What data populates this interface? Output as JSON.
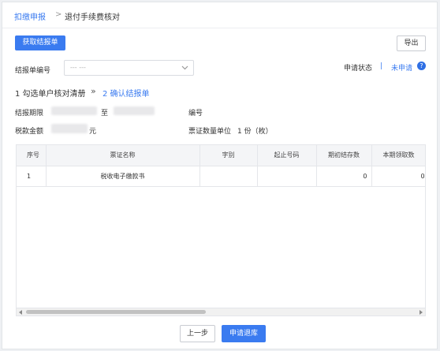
{
  "breadcrumb": {
    "parent": "扣缴申报",
    "separator": ">",
    "current": "退付手续费核对"
  },
  "toolbar": {
    "fetch_button": "获取结报单",
    "export_button": "导出"
  },
  "form": {
    "report_no_label": "结报单编号",
    "report_no_value": "--- ---",
    "status_label": "申请状态",
    "status_divider": "|",
    "status_value": "未申请",
    "help_icon": "?"
  },
  "steps": {
    "step1": "1 勾选单户核对清册",
    "arrow": "»",
    "step2": "2 确认结报单"
  },
  "info": {
    "period_label": "结报期限",
    "to_label": "至",
    "number_label": "编号",
    "tax_amount_label": "税款金额",
    "currency": "元",
    "unit_label": "票证数量单位",
    "unit_value": "1 份（枚）"
  },
  "table": {
    "headers": [
      "序号",
      "票证名称",
      "字别",
      "起止号码",
      "期初结存数",
      "本期领取数"
    ],
    "rows": [
      {
        "seq": "1",
        "name": "税收电子缴款书",
        "type": "",
        "range": "",
        "opening": "0",
        "received": "0"
      }
    ]
  },
  "footer": {
    "prev_button": "上一步",
    "submit_button": "申请退库"
  },
  "colors": {
    "primary": "#3a7bf0",
    "link": "#3a7bf0",
    "help": "#2f6fe4"
  },
  "icons": {
    "dropdown": "chevron-down-icon",
    "help": "help-circle-icon"
  }
}
